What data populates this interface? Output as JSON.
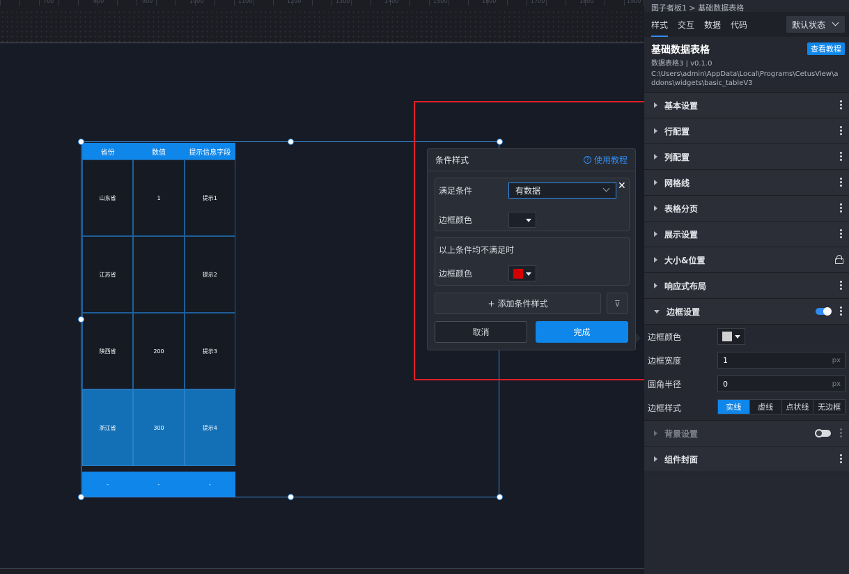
{
  "ruler": {
    "labels": [
      "700",
      "800",
      "900",
      "1000",
      "1100",
      "1200",
      "1300",
      "1400",
      "1500",
      "1600",
      "1700",
      "1800",
      "1900"
    ]
  },
  "table": {
    "headers": [
      "省份",
      "数值",
      "提示信息字段"
    ],
    "rows": [
      [
        "山东省",
        "1",
        "提示1"
      ],
      [
        "江苏省",
        "",
        "提示2"
      ],
      [
        "陕西省",
        "200",
        "提示3"
      ],
      [
        "浙江省",
        "300",
        "提示4"
      ]
    ],
    "footer": [
      "-",
      "-",
      "-"
    ]
  },
  "popup": {
    "title": "条件样式",
    "help_label": "使用教程",
    "condition_label": "满足条件",
    "condition_value": "有数据",
    "border_color_label": "边框颜色",
    "else_label": "以上条件均不满足时",
    "else_border_color_label": "边框颜色",
    "else_border_color": "#d40000",
    "add_label": "添加条件样式",
    "cancel_label": "取消",
    "ok_label": "完成"
  },
  "panel": {
    "breadcrumb": "图子者板1 > 基础数据表格",
    "tabs": [
      "样式",
      "交互",
      "数据",
      "代码"
    ],
    "state_select": "默认状态",
    "widget_title": "基础数据表格",
    "widget_version": "数据表格3 | v0.1.0",
    "widget_path": "C:\\Users\\admin\\AppData\\Local\\Programs\\CetusView\\addons\\widgets\\basic_tableV3",
    "tutorial_button": "查看教程",
    "sections_top": [
      "基本设置",
      "行配置",
      "列配置",
      "网格线",
      "表格分页",
      "展示设置"
    ],
    "size_position": "大小&位置",
    "responsive": "响应式布局",
    "border_settings": "边框设置",
    "border": {
      "color_label": "边框颜色",
      "color_value": "#d0d0d0",
      "width_label": "边框宽度",
      "width_value": "1",
      "radius_label": "圆角半径",
      "radius_value": "0",
      "unit": "px",
      "style_label": "边框样式",
      "styles": [
        "实线",
        "虚线",
        "点状线",
        "无边框"
      ]
    },
    "background_settings": "背景设置",
    "cover": "组件封面"
  },
  "colors": {
    "accent": "#0f86ea",
    "highlight_frame": "#e11f27"
  }
}
